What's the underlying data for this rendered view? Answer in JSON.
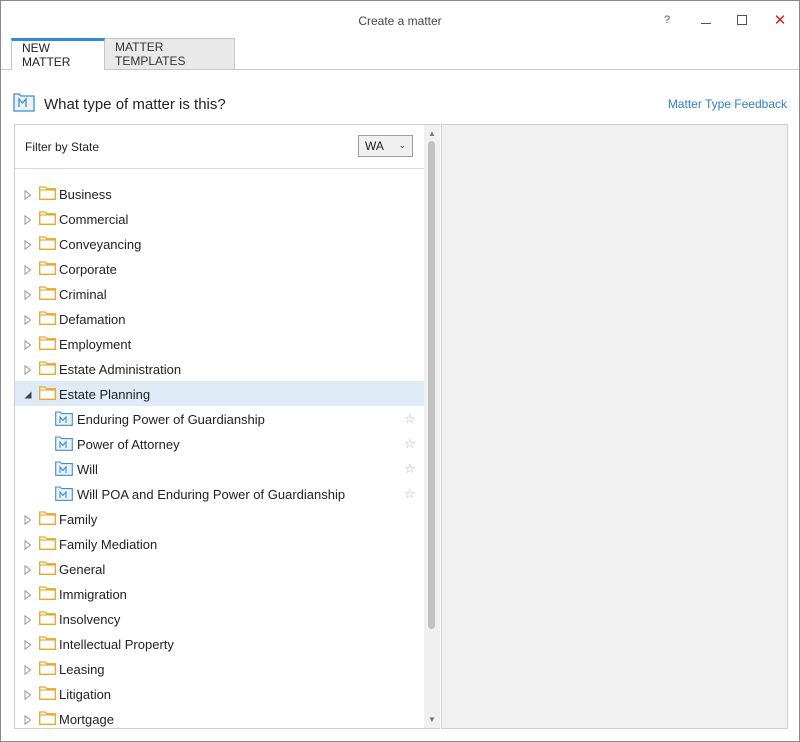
{
  "window": {
    "title": "Create a matter",
    "help_glyph": "?",
    "close_glyph": "✕"
  },
  "tabs": [
    {
      "label": "NEW MATTER",
      "active": true
    },
    {
      "label": "MATTER TEMPLATES",
      "active": false
    }
  ],
  "heading": {
    "text": "What type of matter is this?",
    "feedback_link": "Matter Type Feedback"
  },
  "filter": {
    "label": "Filter by State",
    "selected": "WA"
  },
  "tree": {
    "categories_before": [
      "Business",
      "Commercial",
      "Conveyancing",
      "Corporate",
      "Criminal",
      "Defamation",
      "Employment",
      "Estate Administration"
    ],
    "expanded": {
      "label": "Estate Planning",
      "children": [
        "Enduring Power of Guardianship",
        "Power of Attorney",
        "Will",
        "Will POA and Enduring Power of Guardianship"
      ]
    },
    "categories_after": [
      "Family",
      "Family Mediation",
      "General",
      "Immigration",
      "Insolvency",
      "Intellectual Property",
      "Leasing",
      "Litigation",
      "Mortgage"
    ]
  },
  "colors": {
    "accent": "#2f8bd6",
    "folder": "#e8a72b",
    "selected_row": "#deebf7",
    "link": "#2f7fc4",
    "close": "#d81e1e"
  },
  "icons": {
    "folder": "folder-icon",
    "matter": "matter-type-icon",
    "star": "star-outline-icon",
    "expand": "triangle-right-icon",
    "collapse": "triangle-down-icon"
  }
}
